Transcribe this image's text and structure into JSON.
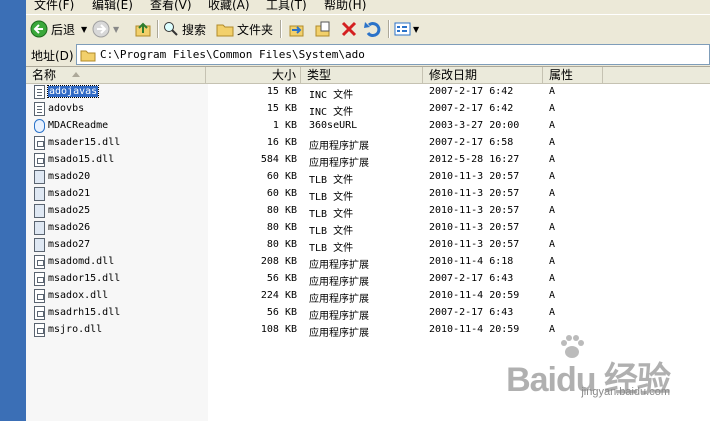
{
  "menu": [
    "文件(F)",
    "编辑(E)",
    "查看(V)",
    "收藏(A)",
    "工具(T)",
    "帮助(H)"
  ],
  "toolbar": {
    "back_label": "后退",
    "search_label": "搜索",
    "folders_label": "文件夹"
  },
  "address": {
    "label": "地址(D)",
    "path": "C:\\Program Files\\Common Files\\System\\ado"
  },
  "columns": {
    "name": "名称",
    "size": "大小",
    "type": "类型",
    "date": "修改日期",
    "attr": "属性"
  },
  "files": [
    {
      "name": "adojavas",
      "size": "15 KB",
      "type": "INC 文件",
      "date": "2007-2-17 6:42",
      "attr": "A",
      "icon": "inc-file-icon",
      "selected": true
    },
    {
      "name": "adovbs",
      "size": "15 KB",
      "type": "INC 文件",
      "date": "2007-2-17 6:42",
      "attr": "A",
      "icon": "inc-file-icon"
    },
    {
      "name": "MDACReadme",
      "size": "1 KB",
      "type": "360seURL",
      "date": "2003-3-27 20:00",
      "attr": "A",
      "icon": "url-file-icon"
    },
    {
      "name": "msader15.dll",
      "size": "16 KB",
      "type": "应用程序扩展",
      "date": "2007-2-17 6:58",
      "attr": "A",
      "icon": "dll-file-icon"
    },
    {
      "name": "msado15.dll",
      "size": "584 KB",
      "type": "应用程序扩展",
      "date": "2012-5-28 16:27",
      "attr": "A",
      "icon": "dll-file-icon"
    },
    {
      "name": "msado20",
      "size": "60 KB",
      "type": "TLB 文件",
      "date": "2010-11-3 20:57",
      "attr": "A",
      "icon": "tlb-file-icon"
    },
    {
      "name": "msado21",
      "size": "60 KB",
      "type": "TLB 文件",
      "date": "2010-11-3 20:57",
      "attr": "A",
      "icon": "tlb-file-icon"
    },
    {
      "name": "msado25",
      "size": "80 KB",
      "type": "TLB 文件",
      "date": "2010-11-3 20:57",
      "attr": "A",
      "icon": "tlb-file-icon"
    },
    {
      "name": "msado26",
      "size": "80 KB",
      "type": "TLB 文件",
      "date": "2010-11-3 20:57",
      "attr": "A",
      "icon": "tlb-file-icon"
    },
    {
      "name": "msado27",
      "size": "80 KB",
      "type": "TLB 文件",
      "date": "2010-11-3 20:57",
      "attr": "A",
      "icon": "tlb-file-icon"
    },
    {
      "name": "msadomd.dll",
      "size": "208 KB",
      "type": "应用程序扩展",
      "date": "2010-11-4 6:18",
      "attr": "A",
      "icon": "dll-file-icon"
    },
    {
      "name": "msador15.dll",
      "size": "56 KB",
      "type": "应用程序扩展",
      "date": "2007-2-17 6:43",
      "attr": "A",
      "icon": "dll-file-icon"
    },
    {
      "name": "msadox.dll",
      "size": "224 KB",
      "type": "应用程序扩展",
      "date": "2010-11-4 20:59",
      "attr": "A",
      "icon": "dll-file-icon"
    },
    {
      "name": "msadrh15.dll",
      "size": "56 KB",
      "type": "应用程序扩展",
      "date": "2007-2-17 6:43",
      "attr": "A",
      "icon": "dll-file-icon"
    },
    {
      "name": "msjro.dll",
      "size": "108 KB",
      "type": "应用程序扩展",
      "date": "2010-11-4 20:59",
      "attr": "A",
      "icon": "dll-file-icon"
    }
  ],
  "watermark": {
    "main": "Baidu 经验",
    "sub": "jingyan.baidu.com"
  }
}
